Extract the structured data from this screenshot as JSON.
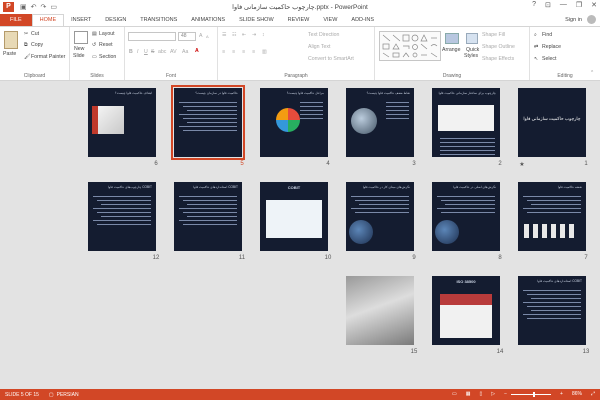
{
  "title_bar": {
    "app_icon": "P",
    "document_title": "چارچوب حاکمیت سازمانی فاوا.pptx - PowerPoint",
    "qat_icons": [
      "save-icon",
      "undo-icon",
      "redo-icon",
      "start-presentation-icon"
    ]
  },
  "window": {
    "help": "?",
    "minimize": "—",
    "restore": "❐",
    "close": "✕"
  },
  "tabs": [
    "FILE",
    "HOME",
    "INSERT",
    "DESIGN",
    "TRANSITIONS",
    "ANIMATIONS",
    "SLIDE SHOW",
    "REVIEW",
    "VIEW",
    "ADD-INS"
  ],
  "signin": "Sign in",
  "ribbon": {
    "clipboard": {
      "label": "Clipboard",
      "paste": "Paste",
      "cut": "Cut",
      "copy": "Copy",
      "format_painter": "Format Painter"
    },
    "slides": {
      "label": "Slides",
      "new_slide": "New",
      "new_slide2": "Slide",
      "layout": "Layout",
      "reset": "Reset",
      "section": "Section"
    },
    "font": {
      "label": "Font",
      "size": "48",
      "bold": "B",
      "italic": "I",
      "underline": "U",
      "strike": "S",
      "shadow": "abc",
      "spacing": "AV",
      "case": "Aa",
      "grow": "A",
      "shrink": "A"
    },
    "paragraph": {
      "label": "Paragraph",
      "text_direction": "Text Direction",
      "align_text": "Align Text",
      "convert_smartart": "Convert to SmartArt"
    },
    "drawing": {
      "label": "Drawing",
      "arrange": "Arrange",
      "quick_styles": "Quick",
      "quick_styles2": "Styles",
      "shape_fill": "Shape Fill",
      "shape_outline": "Shape Outline",
      "shape_effects": "Shape Effects"
    },
    "editing": {
      "label": "Editing",
      "find": "Find",
      "replace": "Replace",
      "select": "Select"
    }
  },
  "slides": [
    {
      "num": "1",
      "title": "چارچوب حاکمیت سازمانی فاوا"
    },
    {
      "num": "2",
      "title": "چارچوب برای ساختار سازمانی حاکمیت فاوا"
    },
    {
      "num": "3",
      "title": "نقاط ضعف حاکمیت فاوا چیست؟"
    },
    {
      "num": "4",
      "title": "مراحل حاکمیت فاوا چیست؟"
    },
    {
      "num": "5",
      "title": "حاکمیت فاوا در سازمان چیست؟"
    },
    {
      "num": "6",
      "title": "اهداف حاکمیت فاوا چیست؟"
    },
    {
      "num": "7",
      "title": "نقشه حاکمیت فاوا"
    },
    {
      "num": "8",
      "title": "نگرش‌های اصلی در حاکمیت فاوا"
    },
    {
      "num": "9",
      "title": "نگرش‌های مبنای کار در حاکمیت فاوا"
    },
    {
      "num": "10",
      "title": "COBIT"
    },
    {
      "num": "11",
      "title": "استانداردهای حاکمیت فاوا COBIT"
    },
    {
      "num": "12",
      "title": "چارچوب‌های حاکمیت فاوا COBIT"
    },
    {
      "num": "13",
      "title": "استانداردهای حاکمیت فاوا COBIT"
    },
    {
      "num": "14",
      "title": "ISO 38500"
    },
    {
      "num": "15",
      "title": ""
    }
  ],
  "slide_star": "★",
  "status": {
    "slide_info": "SLIDE 5 OF 15",
    "language": "PERSIAN",
    "zoom": "86%",
    "zoom_fraction": 0.57,
    "zoom_minus": "−",
    "zoom_plus": "+",
    "zoom_fit": "⤢"
  },
  "colors": {
    "accent": "#d24726",
    "slide_bg": "#141c30"
  }
}
